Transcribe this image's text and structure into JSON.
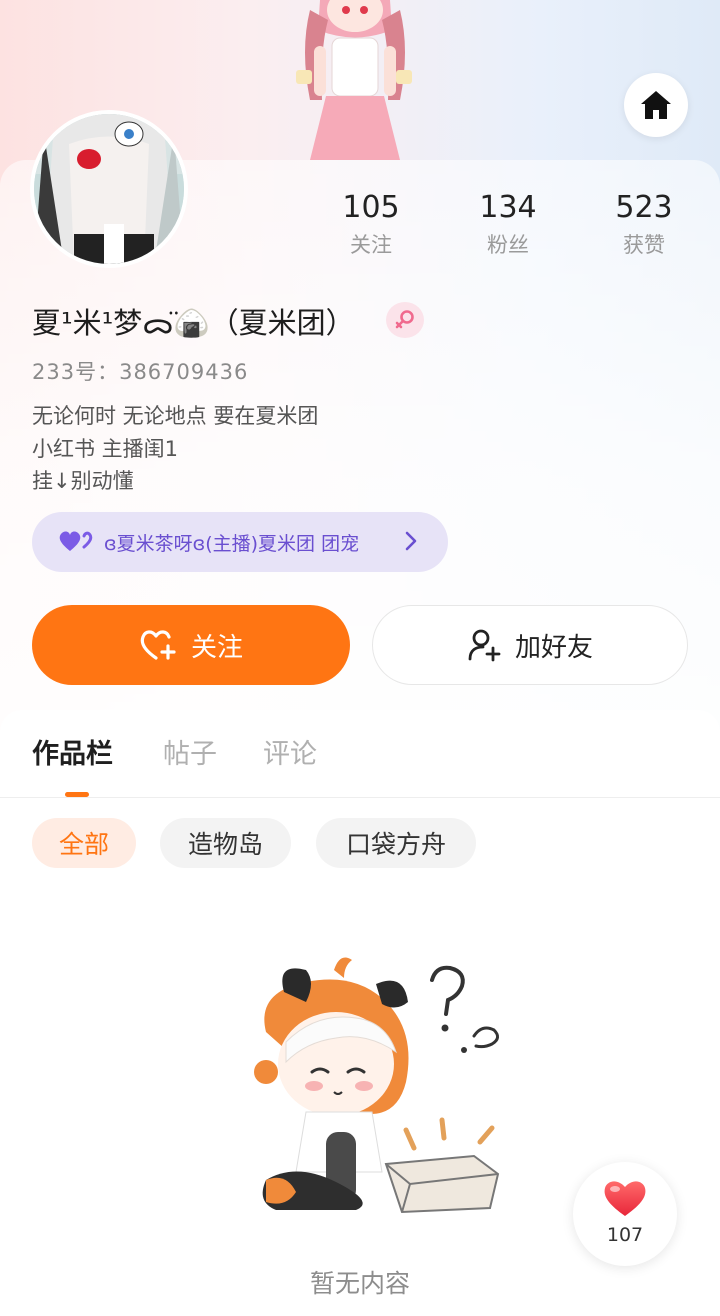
{
  "header": {
    "home_icon": "home-icon"
  },
  "profile": {
    "stats": [
      {
        "value": "105",
        "label": "关注"
      },
      {
        "value": "134",
        "label": "粉丝"
      },
      {
        "value": "523",
        "label": "获赞"
      }
    ],
    "display_name": "夏¹米¹梦ᯅ̈🍙（夏米团）",
    "gender_icon": "female-icon",
    "id_line": "233号：386709436",
    "bio_lines": [
      "无论何时 无论地点 要在夏米团",
      "小红书 主播闺1",
      "挂↓别动懂"
    ],
    "fan_group": {
      "icon": "purple-hearts-icon",
      "text": "ɞ夏米茶呀ɞ(主播)夏米团 团宠"
    }
  },
  "actions": {
    "follow_label": "关注",
    "add_friend_label": "加好友"
  },
  "tabs": [
    {
      "label": "作品栏",
      "active": true
    },
    {
      "label": "帖子",
      "active": false
    },
    {
      "label": "评论",
      "active": false
    }
  ],
  "filters": [
    {
      "label": "全部",
      "active": true
    },
    {
      "label": "造物岛",
      "active": false
    },
    {
      "label": "口袋方舟",
      "active": false
    }
  ],
  "empty_state": {
    "text": "暂无内容"
  },
  "like_float": {
    "count": "107"
  },
  "colors": {
    "accent": "#ff7513",
    "fan_text": "#6a4fd0",
    "fan_bg": "#e7e3f7"
  }
}
